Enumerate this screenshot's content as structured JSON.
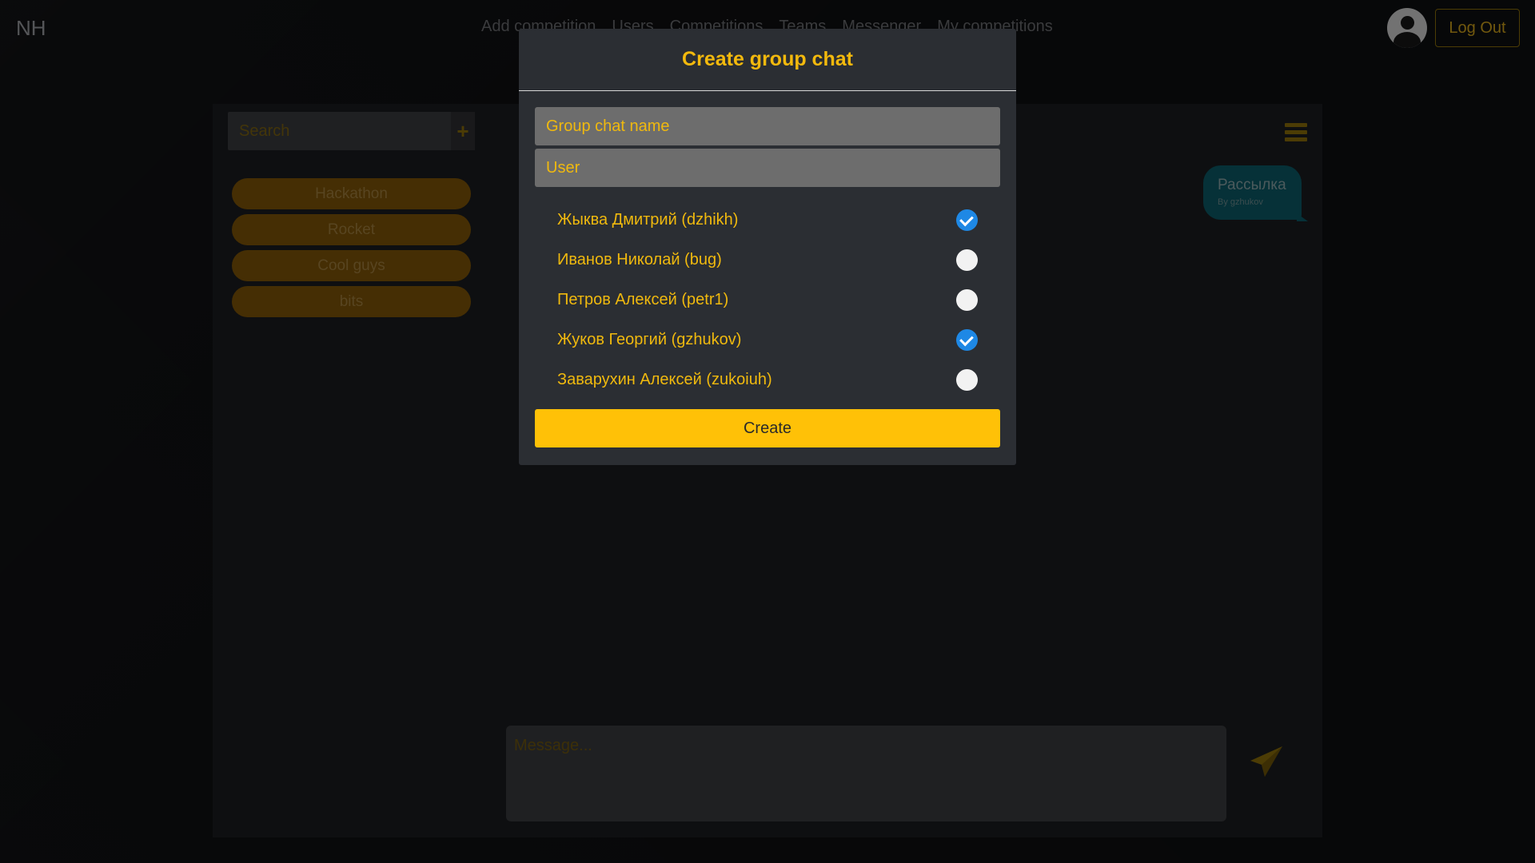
{
  "navbar": {
    "brand": "NH",
    "links": [
      "Add competition",
      "Users",
      "Competitions",
      "Teams",
      "Messenger",
      "My competitions"
    ],
    "logout_label": "Log Out"
  },
  "sidebar": {
    "search_placeholder": "Search",
    "add_label": "+",
    "chats": [
      "Hackathon",
      "Rocket",
      "Cool guys",
      "bits"
    ]
  },
  "conversation": {
    "message_text": "Рассылка",
    "message_author": "By gzhukov"
  },
  "composer": {
    "placeholder": "Message..."
  },
  "modal": {
    "title": "Create group chat",
    "name_placeholder": "Group chat name",
    "user_placeholder": "User",
    "users": [
      {
        "name": "Жыква Дмитрий (dzhikh)",
        "checked": true
      },
      {
        "name": "Иванов Николай (bug)",
        "checked": false
      },
      {
        "name": "Петров Алексей (petr1)",
        "checked": false
      },
      {
        "name": "Жуков Георгий (gzhukov)",
        "checked": true
      },
      {
        "name": "Заварухин Алексей (zukoiuh)",
        "checked": false
      }
    ],
    "create_label": "Create"
  },
  "colors": {
    "accent": "#ffc107",
    "text_accent": "#f0b90e",
    "check_on": "#1e88e5",
    "bubble": "#0b5a66"
  }
}
